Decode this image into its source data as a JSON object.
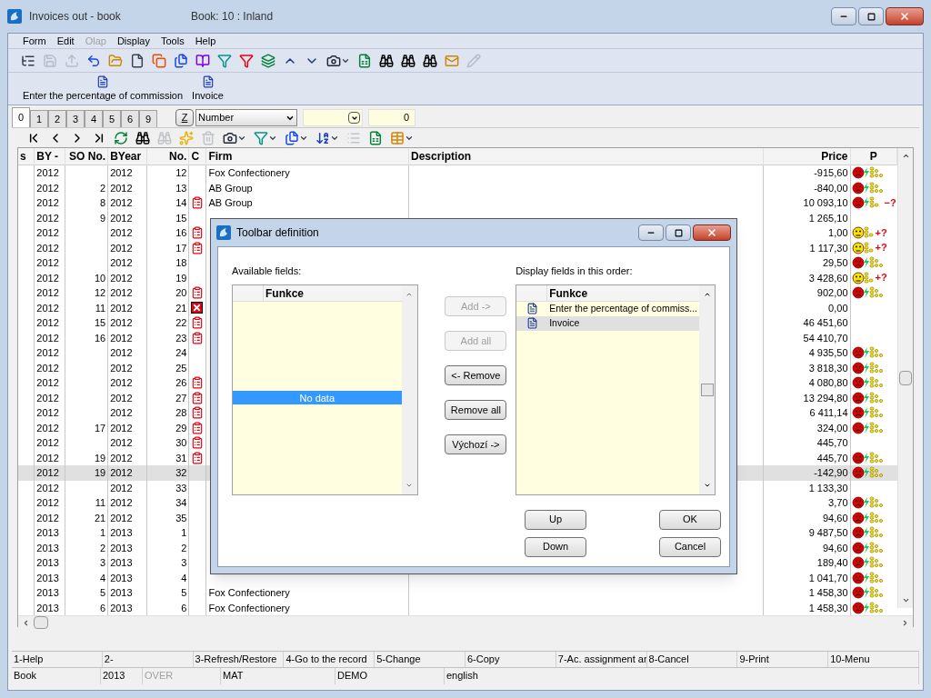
{
  "window": {
    "title": "Invoices out - book",
    "subtitle": "Book: 10 : Inland"
  },
  "menu": [
    {
      "label": "Form",
      "disabled": false
    },
    {
      "label": "Edit",
      "disabled": false
    },
    {
      "label": "Olap",
      "disabled": true
    },
    {
      "label": "Display",
      "disabled": false
    },
    {
      "label": "Tools",
      "disabled": false
    },
    {
      "label": "Help",
      "disabled": false
    }
  ],
  "toolbar": [
    {
      "kind": "tree",
      "disabled": false
    },
    {
      "kind": "save",
      "disabled": true
    },
    {
      "kind": "export",
      "disabled": true
    },
    {
      "kind": "undo",
      "disabled": false
    },
    {
      "kind": "folder",
      "disabled": false
    },
    {
      "kind": "file",
      "disabled": false
    },
    {
      "kind": "copy",
      "disabled": false
    },
    {
      "kind": "files",
      "disabled": false
    },
    {
      "kind": "book",
      "disabled": false
    },
    {
      "kind": "filter",
      "disabled": false
    },
    {
      "kind": "filterdoc",
      "disabled": false
    },
    {
      "kind": "stack",
      "disabled": false
    },
    {
      "kind": "up",
      "disabled": false
    },
    {
      "kind": "down",
      "disabled": false
    },
    {
      "kind": "camera",
      "disabled": false,
      "dropdown": true
    },
    {
      "kind": "excel",
      "disabled": false
    },
    {
      "kind": "binoculars",
      "disabled": false
    },
    {
      "kind": "binoculars",
      "disabled": false
    },
    {
      "kind": "binoculars",
      "disabled": false
    },
    {
      "kind": "mail",
      "disabled": false
    },
    {
      "kind": "edit",
      "disabled": true
    }
  ],
  "custom_toolbar": [
    {
      "label": "Enter the percentage of commission"
    },
    {
      "label": "Invoice"
    }
  ],
  "tabs": [
    {
      "label": "0",
      "selected": true
    },
    {
      "label": "1",
      "selected": false
    },
    {
      "label": "2",
      "selected": false
    },
    {
      "label": "3",
      "selected": false
    },
    {
      "label": "4",
      "selected": false
    },
    {
      "label": "5",
      "selected": false
    },
    {
      "label": "6",
      "selected": false
    },
    {
      "label": "9",
      "selected": false
    }
  ],
  "filter": {
    "z_button": "Z",
    "combo": "Number",
    "value": "0"
  },
  "nav_toolbar": [
    {
      "kind": "first",
      "disabled": false
    },
    {
      "kind": "prev",
      "disabled": false
    },
    {
      "kind": "next",
      "disabled": false
    },
    {
      "kind": "last",
      "disabled": false
    },
    {
      "kind": "refresh",
      "disabled": false
    },
    {
      "kind": "binoculars",
      "disabled": false
    },
    {
      "kind": "binoculars",
      "disabled": true
    },
    {
      "kind": "addstar",
      "disabled": false
    },
    {
      "kind": "remove",
      "disabled": true
    },
    {
      "kind": "camera",
      "disabled": false,
      "dropdown": true
    },
    {
      "kind": "filter",
      "disabled": false,
      "dropdown": true
    },
    {
      "kind": "files",
      "disabled": false,
      "dropdown": true
    },
    {
      "kind": "sort",
      "disabled": false,
      "dropdown": true
    },
    {
      "kind": "list",
      "disabled": true
    },
    {
      "kind": "excel",
      "disabled": false
    },
    {
      "kind": "table",
      "disabled": false,
      "dropdown": true
    }
  ],
  "table": {
    "columns": [
      "s",
      "BY -",
      "SO No.",
      "BYear",
      "No.",
      "C",
      "Firm",
      "Description",
      "Price",
      "P"
    ],
    "rows": [
      {
        "by": "2012",
        "byear": "2012",
        "no": "12",
        "firm": "Fox Confectionery",
        "price": "-915,60",
        "p": {
          "kind": "red"
        },
        "selected": false
      },
      {
        "by": "2012",
        "so": "2",
        "byear": "2012",
        "no": "13",
        "firm": "AB Group",
        "price": "-840,00",
        "p": {
          "kind": "red"
        },
        "selected": false
      },
      {
        "by": "2012",
        "so": "8",
        "byear": "2012",
        "no": "14",
        "c": {
          "kind": "copy"
        },
        "firm": "AB Group",
        "price": "10 093,10",
        "p": {
          "kind": "redminus",
          "note": "−?"
        },
        "selected": false
      },
      {
        "by": "2012",
        "so": "9",
        "byear": "2012",
        "no": "15",
        "price": "1 265,10",
        "selected": false
      },
      {
        "by": "2012",
        "byear": "2012",
        "no": "16",
        "c": {
          "kind": "copy"
        },
        "price": "1,00",
        "p": {
          "kind": "yellow",
          "note": "+?"
        },
        "selected": false
      },
      {
        "by": "2012",
        "byear": "2012",
        "no": "17",
        "c": {
          "kind": "copy"
        },
        "price": "1 117,30",
        "p": {
          "kind": "yellow",
          "note": "+?"
        },
        "selected": false
      },
      {
        "by": "2012",
        "byear": "2012",
        "no": "18",
        "price": "29,50",
        "p": {
          "kind": "red"
        },
        "selected": false
      },
      {
        "by": "2012",
        "so": "10",
        "byear": "2012",
        "no": "19",
        "price": "3 428,60",
        "p": {
          "kind": "yellow",
          "note": "+?"
        },
        "selected": false
      },
      {
        "by": "2012",
        "so": "12",
        "byear": "2012",
        "no": "20",
        "c": {
          "kind": "copy"
        },
        "price": "902,00",
        "p": {
          "kind": "red"
        },
        "selected": false
      },
      {
        "by": "2012",
        "so": "11",
        "byear": "2012",
        "no": "21",
        "c": {
          "kind": "cancel"
        },
        "price": "0,00",
        "selected": false
      },
      {
        "by": "2012",
        "so": "15",
        "byear": "2012",
        "no": "22",
        "c": {
          "kind": "copy"
        },
        "price": "46 451,60",
        "selected": false
      },
      {
        "by": "2012",
        "so": "16",
        "byear": "2012",
        "no": "23",
        "c": {
          "kind": "copy"
        },
        "price": "54 410,70",
        "selected": false
      },
      {
        "by": "2012",
        "byear": "2012",
        "no": "24",
        "price": "4 935,50",
        "p": {
          "kind": "red"
        },
        "selected": false
      },
      {
        "by": "2012",
        "byear": "2012",
        "no": "25",
        "price": "3 818,30",
        "p": {
          "kind": "red"
        },
        "selected": false
      },
      {
        "by": "2012",
        "byear": "2012",
        "no": "26",
        "c": {
          "kind": "copy"
        },
        "price": "4 080,80",
        "p": {
          "kind": "red"
        },
        "selected": false
      },
      {
        "by": "2012",
        "byear": "2012",
        "no": "27",
        "c": {
          "kind": "copy"
        },
        "price": "13 294,80",
        "p": {
          "kind": "red"
        },
        "selected": false
      },
      {
        "by": "2012",
        "byear": "2012",
        "no": "28",
        "c": {
          "kind": "copy"
        },
        "price": "6 411,14",
        "p": {
          "kind": "red"
        },
        "selected": false
      },
      {
        "by": "2012",
        "so": "17",
        "byear": "2012",
        "no": "29",
        "c": {
          "kind": "copy"
        },
        "price": "324,00",
        "p": {
          "kind": "red"
        },
        "selected": false
      },
      {
        "by": "2012",
        "byear": "2012",
        "no": "30",
        "c": {
          "kind": "copy"
        },
        "price": "445,70",
        "selected": false
      },
      {
        "by": "2012",
        "so": "19",
        "byear": "2012",
        "no": "31",
        "c": {
          "kind": "copy"
        },
        "price": "445,70",
        "p": {
          "kind": "red"
        },
        "selected": false
      },
      {
        "by": "2012",
        "so": "19",
        "byear": "2012",
        "no": "32",
        "price": "-142,90",
        "p": {
          "kind": "red"
        },
        "selected": true
      },
      {
        "by": "2012",
        "byear": "2012",
        "no": "33",
        "price": "1 133,30",
        "selected": false
      },
      {
        "by": "2012",
        "so": "11",
        "byear": "2012",
        "no": "34",
        "price": "3,70",
        "p": {
          "kind": "red"
        },
        "selected": false
      },
      {
        "by": "2012",
        "so": "21",
        "byear": "2012",
        "no": "35",
        "price": "94,60",
        "p": {
          "kind": "red"
        },
        "selected": false
      },
      {
        "by": "2013",
        "so": "1",
        "byear": "2013",
        "no": "1",
        "price": "9 487,50",
        "p": {
          "kind": "red"
        },
        "selected": false
      },
      {
        "by": "2013",
        "so": "2",
        "byear": "2013",
        "no": "2",
        "price": "94,60",
        "p": {
          "kind": "red"
        },
        "selected": false
      },
      {
        "by": "2013",
        "so": "3",
        "byear": "2013",
        "no": "3",
        "price": "189,40",
        "p": {
          "kind": "red"
        },
        "selected": false
      },
      {
        "by": "2013",
        "so": "4",
        "byear": "2013",
        "no": "4",
        "price": "1 041,70",
        "p": {
          "kind": "red"
        },
        "selected": false
      },
      {
        "by": "2013",
        "so": "5",
        "byear": "2013",
        "no": "5",
        "firm": "Fox Confectionery",
        "price": "1 458,30",
        "p": {
          "kind": "red"
        },
        "selected": false
      },
      {
        "by": "2013",
        "so": "6",
        "byear": "2013",
        "no": "6",
        "firm": "Fox Confectionery",
        "price": "1 458,30",
        "p": {
          "kind": "red"
        },
        "selected": false
      }
    ]
  },
  "function_keys": [
    "1-Help",
    "2-",
    "3-Refresh/Restore",
    "4-Go to the record",
    "5-Change",
    "6-Copy",
    "7-Ac. assignment ar",
    "8-Cancel",
    "9-Print",
    "10-Menu"
  ],
  "status_bar": [
    {
      "text": "Book"
    },
    {
      "text": "2013"
    },
    {
      "text": "OVER",
      "disabled": true
    },
    {
      "text": "MAT"
    },
    {
      "text": "DEMO"
    },
    {
      "text": "english"
    }
  ],
  "dialog": {
    "title": "Toolbar definition",
    "available_label": "Available fields:",
    "available_header": "Funkce",
    "available_empty": "No data",
    "display_label": "Display fields in this order:",
    "display_header": "Funkce",
    "display_items": [
      {
        "label": "Enter the percentage of commiss...",
        "selected": false
      },
      {
        "label": "Invoice",
        "selected": true
      }
    ],
    "middle_buttons": [
      {
        "label": "Add ->",
        "disabled": true
      },
      {
        "label": "Add all",
        "disabled": true
      },
      {
        "label": "<- Remove",
        "disabled": false
      },
      {
        "label": "Remove all",
        "disabled": false
      },
      {
        "label": "Výchozí ->",
        "disabled": false
      }
    ],
    "order_buttons": [
      {
        "label": "Up"
      },
      {
        "label": "Down"
      }
    ],
    "confirm_buttons": [
      {
        "label": "OK"
      },
      {
        "label": "Cancel"
      }
    ]
  }
}
